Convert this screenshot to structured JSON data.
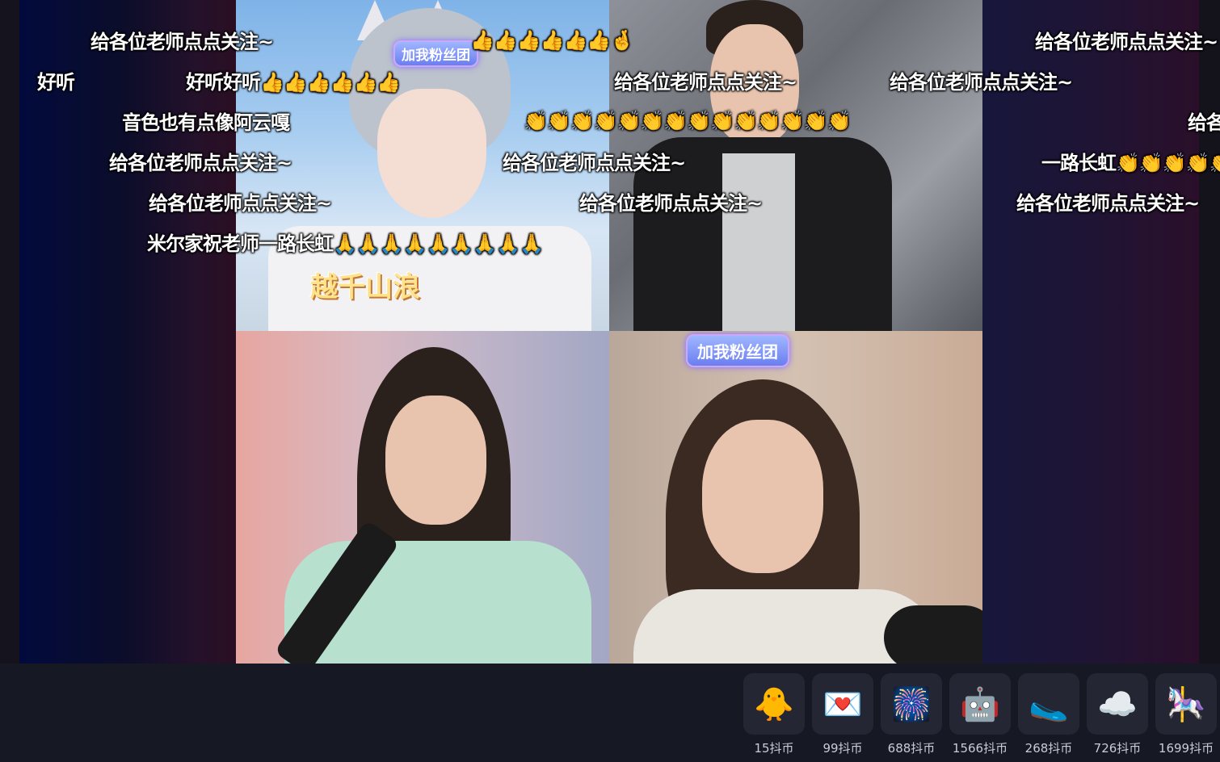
{
  "danmaku": [
    "给各位老师点点关注~",
    "👍👍👍👍👍👍🤞",
    "给各位老师点点关注~",
    "好听",
    "好听好听👍👍👍👍👍👍",
    "给各位老师点点关注~",
    "给各位老师点点关注~",
    "音色也有点像阿云嘎",
    "👏👏👏👏👏👏👏👏👏👏👏👏👏👏",
    "给各",
    "给各位老师点点关注~",
    "给各位老师点点关注~",
    "一路长虹👏👏👏👏👏",
    "给各位老师点点关注~",
    "给各位老师点点关注~",
    "给各位老师点点关注~",
    "米尔家祝老师一路长虹🙏🙏🙏🙏🙏🙏🙏🙏🙏"
  ],
  "tiles": {
    "top_left": {
      "badge": "加我粉丝团",
      "caption": "越千山浪"
    },
    "bottom_right": {
      "badge": "加我粉丝团"
    }
  },
  "gifts": [
    {
      "icon": "duck-cheer-icon",
      "emoji": "🐥",
      "price": "15抖币"
    },
    {
      "icon": "love-letter-icon",
      "emoji": "💌",
      "price": "99抖币"
    },
    {
      "icon": "666-fireworks-icon",
      "emoji": "🎆",
      "price": "688抖币"
    },
    {
      "icon": "robot-mascot-icon",
      "emoji": "🤖",
      "price": "1566抖币"
    },
    {
      "icon": "golden-shoes-icon",
      "emoji": "🥿",
      "price": "268抖币"
    },
    {
      "icon": "pink-cloud-icon",
      "emoji": "☁️",
      "price": "726抖币"
    },
    {
      "icon": "carousel-swing-icon",
      "emoji": "🎠",
      "price": "1699抖币"
    }
  ]
}
